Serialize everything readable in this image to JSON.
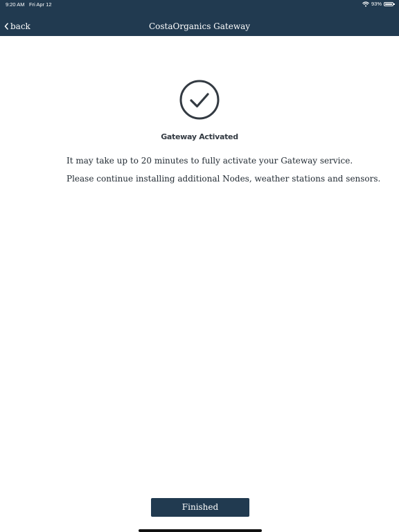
{
  "status_bar": {
    "time": "9:20 AM",
    "date": "Fri Apr 12",
    "battery": "93%",
    "icons": [
      "wifi-icon",
      "battery-icon"
    ]
  },
  "nav": {
    "back_label": "back",
    "title": "CostaOrganics Gateway",
    "back_icon": "chevron-left-icon"
  },
  "content": {
    "status_icon": "check-circle-icon",
    "title": "Gateway Activated",
    "messages": [
      "It may take up to 20 minutes to fully activate your Gateway service.",
      "Please continue installing additional Nodes, weather stations and sensors."
    ]
  },
  "footer": {
    "finished_label": "Finished"
  },
  "colors": {
    "header_bg": "#213a50",
    "button_bg": "#213a50",
    "icon_stroke": "#333a42",
    "text": "#222b33"
  }
}
